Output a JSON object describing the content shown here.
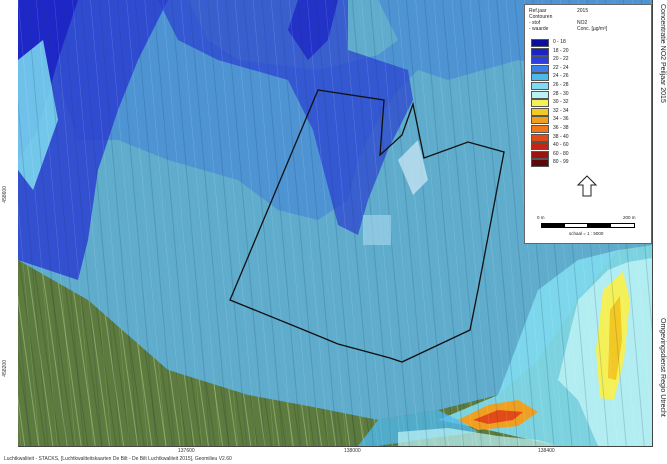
{
  "map": {
    "title": "Concentratie NO2 Peiljaar 2015",
    "organisation": "Omgevingsdienst Regio Utrecht",
    "credit": "Luchtkwaliteit - STACKS, [Luchtkwaliteitskaarten De Bilt - De Bilt Luchtkwaliteit 2015], Geomilieu V2.60",
    "y_ticks": [
      "458600",
      "458200"
    ],
    "x_ticks": [
      "137600",
      "138000",
      "138400"
    ]
  },
  "legend": {
    "meta": [
      {
        "label": "Ref.jaar",
        "value": "2015"
      },
      {
        "label": "Contouren",
        "value": ""
      },
      {
        "label": "- stof",
        "value": "NO2"
      },
      {
        "label": "- waarde",
        "value": "Conc. [µg/m³]"
      }
    ],
    "classes": [
      {
        "label": "0 - 18",
        "color": "#0a0f9c"
      },
      {
        "label": "18 - 20",
        "color": "#1c23c4"
      },
      {
        "label": "20 - 22",
        "color": "#2e3fe0"
      },
      {
        "label": "22 - 24",
        "color": "#3d7fe6"
      },
      {
        "label": "24 - 26",
        "color": "#4fb9ee"
      },
      {
        "label": "26 - 28",
        "color": "#7fdcf0"
      },
      {
        "label": "28 - 30",
        "color": "#b8f0f4"
      },
      {
        "label": "30 - 32",
        "color": "#f4f058"
      },
      {
        "label": "32 - 34",
        "color": "#f2c825"
      },
      {
        "label": "34 - 36",
        "color": "#f0a020"
      },
      {
        "label": "36 - 38",
        "color": "#ec7a1c"
      },
      {
        "label": "38 - 40",
        "color": "#e24a18"
      },
      {
        "label": "40 - 60",
        "color": "#c42414"
      },
      {
        "label": "60 - 80",
        "color": "#9a1510"
      },
      {
        "label": "80 - 99",
        "color": "#5a0a08"
      }
    ],
    "scale_start": "0 m",
    "scale_end": "200 m",
    "scale_text": "schaal = 1 : 5000",
    "north_icon": "north-arrow-icon"
  }
}
